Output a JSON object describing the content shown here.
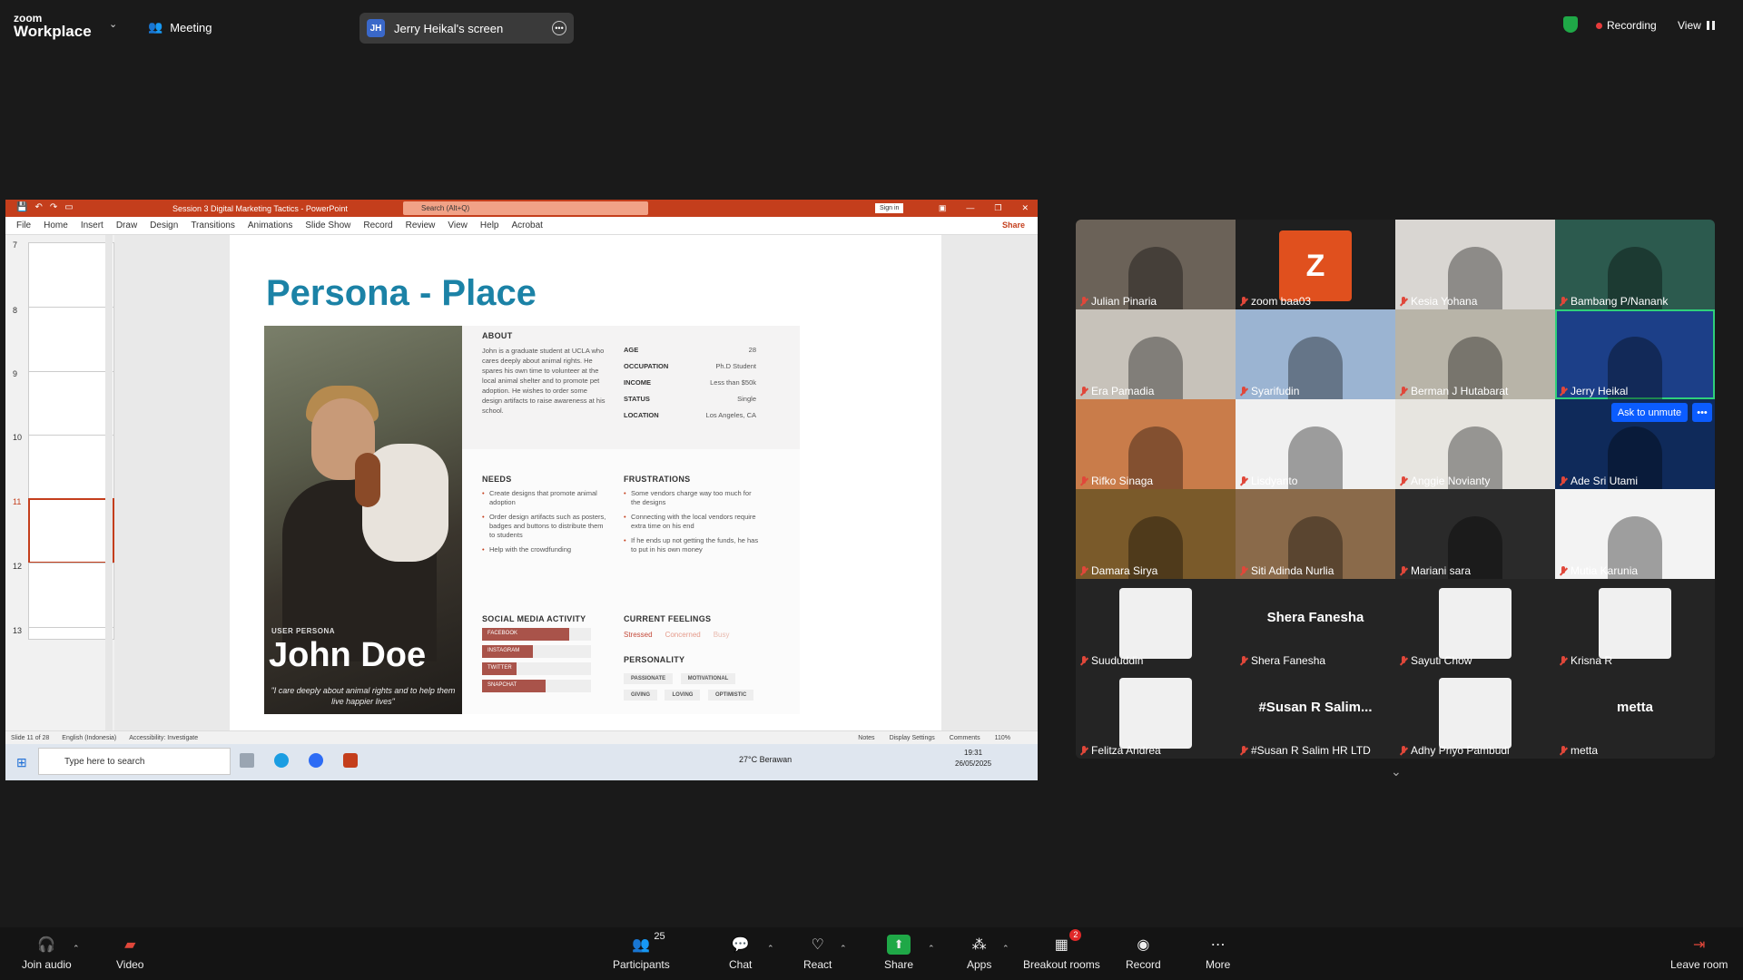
{
  "app": {
    "logo_top": "zoom",
    "logo_bottom": "Workplace",
    "meeting_label": "Meeting"
  },
  "share_indicator": {
    "initials": "JH",
    "label": "Jerry Heikal's screen"
  },
  "top_right": {
    "recording_label": "Recording",
    "view_label": "View"
  },
  "ppt": {
    "title": "Session 3 Digital Marketing Tactics  -  PowerPoint",
    "search_placeholder": "Search (Alt+Q)",
    "sign_in": "Sign in",
    "menu": [
      "File",
      "Home",
      "Insert",
      "Draw",
      "Design",
      "Transitions",
      "Animations",
      "Slide Show",
      "Record",
      "Review",
      "View",
      "Help",
      "Acrobat"
    ],
    "share": "Share",
    "thumb_numbers": [
      "7",
      "8",
      "9",
      "10",
      "11",
      "12",
      "13"
    ],
    "status_left": [
      "Slide 11 of 28",
      "English (Indonesia)",
      "Accessibility: Investigate"
    ],
    "status_right": [
      "Notes",
      "Display Settings",
      "Comments",
      "110%"
    ]
  },
  "slide": {
    "title": "Persona - Place",
    "user_persona": "USER PERSONA",
    "name": "John Doe",
    "quote": "\"I care deeply about animal rights and to help them live happier lives\"",
    "about_h": "ABOUT",
    "about_text": "John is a graduate student at UCLA who cares deeply about animal rights. He spares his own time to volunteer at the local animal shelter and to promote pet adoption. He wishes to order some design artifacts to raise awareness at his school.",
    "facts": [
      {
        "k": "AGE",
        "v": "28"
      },
      {
        "k": "OCCUPATION",
        "v": "Ph.D Student"
      },
      {
        "k": "INCOME",
        "v": "Less than $50k"
      },
      {
        "k": "STATUS",
        "v": "Single"
      },
      {
        "k": "LOCATION",
        "v": "Los Angeles, CA"
      }
    ],
    "needs_h": "NEEDS",
    "needs": [
      "Create designs that promote animal adoption",
      "Order design artifacts such as posters, badges and buttons to distribute them to students",
      "Help with the crowdfunding"
    ],
    "frustrations_h": "FRUSTRATIONS",
    "frustrations": [
      "Some vendors charge way too much for the designs",
      "Connecting with the local vendors require extra time on his end",
      "If he ends up not getting the funds, he has to put in his own money"
    ],
    "social_h": "SOCIAL MEDIA ACTIVITY",
    "social": [
      {
        "name": "FACEBOOK",
        "level": 0.8
      },
      {
        "name": "INSTAGRAM",
        "level": 0.47
      },
      {
        "name": "TWITTER",
        "level": 0.32
      },
      {
        "name": "SNAPCHAT",
        "level": 0.58
      }
    ],
    "feelings_h": "CURRENT FEELINGS",
    "feelings": [
      "Stressed",
      "Concerned",
      "Busy"
    ],
    "personality_h": "PERSONALITY",
    "personality": [
      "PASSIONATE",
      "MOTIVATIONAL",
      "GIVING",
      "LOVING",
      "OPTIMISTIC"
    ]
  },
  "taskbar": {
    "search": "Type here to search",
    "weather": "27°C  Berawan",
    "time": "19:31",
    "date": "26/05/2025"
  },
  "participants": [
    {
      "name": "Julian Pinaria",
      "bg": "#6b6258"
    },
    {
      "name": "zoom baa03",
      "bg": "#1f1f1f",
      "avatar": "Z"
    },
    {
      "name": "Kesia Yohana",
      "bg": "#d9d6d2"
    },
    {
      "name": "Bambang P/Nanank",
      "bg": "#2c5a4e"
    },
    {
      "name": "Era Pamadia",
      "bg": "#c7c2ba"
    },
    {
      "name": "Syarifudin",
      "bg": "#9bb4d2"
    },
    {
      "name": "Berman J Hutabarat",
      "bg": "#b8b4a8"
    },
    {
      "name": "Jerry Heikal",
      "bg": "#1c3f88"
    },
    {
      "name": "Rifko Sinaga",
      "bg": "#c97c4a"
    },
    {
      "name": "Lisdyanto",
      "bg": "#f0f0f0"
    },
    {
      "name": "Anggie Novianty",
      "bg": "#e7e5e0"
    },
    {
      "name": "Ade Sri Utami",
      "bg": "#0f2a5a"
    },
    {
      "name": "Damara Sirya",
      "bg": "#7a5a2a"
    },
    {
      "name": "Siti Adinda Nurlia",
      "bg": "#8a6a4a"
    },
    {
      "name": "Mariani sara",
      "bg": "#2a2a2a"
    },
    {
      "name": "Mutia Karunia",
      "bg": "#f3f3f3"
    },
    {
      "name": "Suududdin",
      "bg": "#242424"
    },
    {
      "name": "Shera Fanesha",
      "bg": "#242424",
      "big": "Shera Fanesha"
    },
    {
      "name": "Sayuti Chow",
      "bg": "#242424"
    },
    {
      "name": "Krisna R",
      "bg": "#242424"
    },
    {
      "name": "Felitza Andrea",
      "bg": "#242424"
    },
    {
      "name": "#Susan R Salim HR LTD",
      "bg": "#242424",
      "big": "#Susan R Salim..."
    },
    {
      "name": "Adhy Priyo Pambudi",
      "bg": "#242424"
    },
    {
      "name": "metta",
      "bg": "#242424",
      "big": "metta"
    }
  ],
  "ask_unmute": "Ask to unmute",
  "toolbar": {
    "join_audio": "Join audio",
    "video": "Video",
    "participants": "Participants",
    "participants_count": "25",
    "chat": "Chat",
    "react": "React",
    "share": "Share",
    "apps": "Apps",
    "breakout": "Breakout rooms",
    "breakout_badge": "2",
    "record": "Record",
    "more": "More",
    "leave": "Leave room"
  },
  "colors": {
    "ppt_red": "#c43e1c",
    "slide_title": "#1b82a6",
    "zoom_blue": "#0b5cff",
    "share_green": "#1fa847",
    "mic_red": "#e0473a"
  }
}
